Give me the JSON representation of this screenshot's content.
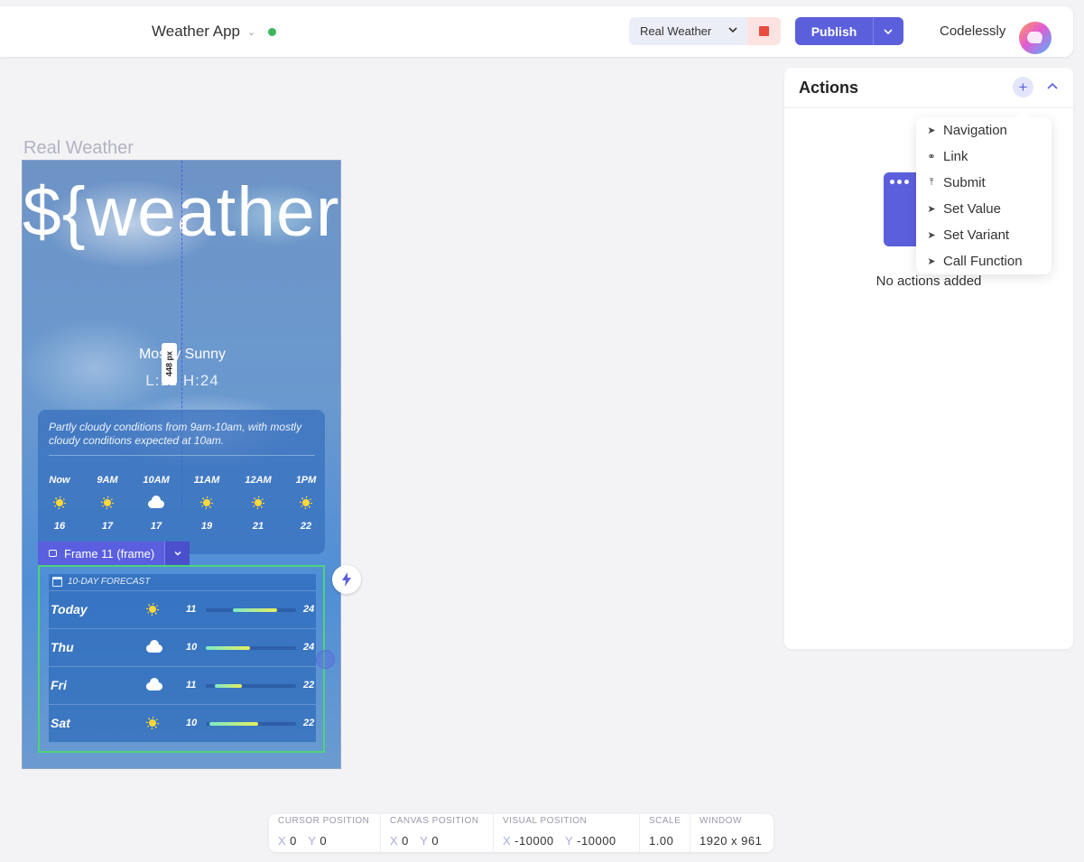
{
  "header": {
    "project_name": "Weather App",
    "layout_select": "Real Weather",
    "publish_label": "Publish",
    "user_name": "Codelessly",
    "status_color": "#3db55a",
    "accent_color": "#5b5fdc"
  },
  "canvas": {
    "frame_label": "Real Weather",
    "guide_measure": "448 px",
    "frame_badge": "Frame 11  (frame)"
  },
  "weather": {
    "temp": "${weather.temp}",
    "condition": "Mostly Sunny",
    "hilo": "L:11 H:24",
    "summary": "Partly cloudy conditions from 9am-10am, with mostly cloudy conditions expected at 10am.",
    "hourly": [
      {
        "time": "Now",
        "icon": "sun-icon",
        "temp": "16"
      },
      {
        "time": "9AM",
        "icon": "sun-icon",
        "temp": "17"
      },
      {
        "time": "10AM",
        "icon": "cloud-icon",
        "temp": "17"
      },
      {
        "time": "11AM",
        "icon": "sun-icon",
        "temp": "19"
      },
      {
        "time": "12AM",
        "icon": "sun-icon",
        "temp": "21"
      },
      {
        "time": "1PM",
        "icon": "sun-icon",
        "temp": "22"
      }
    ],
    "forecast_title": "10-DAY FORECAST",
    "forecast": [
      {
        "day": "Today",
        "icon": "sun-icon",
        "low": "11",
        "high": "24",
        "range_start": 0.3,
        "range_end": 0.79
      },
      {
        "day": "Thu",
        "icon": "cloud-icon",
        "low": "10",
        "high": "24",
        "range_start": 0.0,
        "range_end": 0.49
      },
      {
        "day": "Fri",
        "icon": "cloud-icon",
        "low": "11",
        "high": "22",
        "range_start": 0.1,
        "range_end": 0.4
      },
      {
        "day": "Sat",
        "icon": "sun-icon",
        "low": "10",
        "high": "22",
        "range_start": 0.04,
        "range_end": 0.58
      }
    ]
  },
  "actions_panel": {
    "title": "Actions",
    "empty_text": "No actions added",
    "menu": [
      {
        "label": "Navigation",
        "icon": "send-icon"
      },
      {
        "label": "Link",
        "icon": "link-icon"
      },
      {
        "label": "Submit",
        "icon": "upload-icon"
      },
      {
        "label": "Set Value",
        "icon": "send-icon"
      },
      {
        "label": "Set Variant",
        "icon": "send-icon"
      },
      {
        "label": "Call Function",
        "icon": "send-icon"
      }
    ]
  },
  "status_bar": {
    "cursor": {
      "label": "CURSOR POSITION",
      "x": "0",
      "y": "0"
    },
    "canvas": {
      "label": "CANVAS POSITION",
      "x": "0",
      "y": "0"
    },
    "visual": {
      "label": "VISUAL POSITION",
      "x": "-10000",
      "y": "-10000"
    },
    "scale": {
      "label": "SCALE",
      "value": "1.00"
    },
    "window": {
      "label": "WINDOW",
      "value": "1920 x 961"
    }
  }
}
